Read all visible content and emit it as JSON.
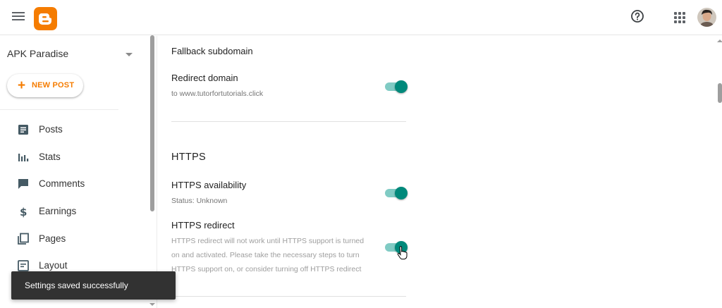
{
  "app": {
    "name": "Blogger",
    "brand_color": "#f57c00",
    "accent_color": "#00897b",
    "icons": {
      "menu": "hamburger-menu-icon",
      "logo": "blogger-logo-icon",
      "help": "help-circle-icon",
      "apps": "apps-grid-icon",
      "avatar": "user-avatar"
    }
  },
  "sidebar": {
    "blog_name": "APK Paradise",
    "new_post_label": "NEW POST",
    "items": [
      {
        "label": "Posts",
        "icon": "posts-icon"
      },
      {
        "label": "Stats",
        "icon": "stats-icon"
      },
      {
        "label": "Comments",
        "icon": "comments-icon"
      },
      {
        "label": "Earnings",
        "icon": "dollar-icon"
      },
      {
        "label": "Pages",
        "icon": "pages-icon"
      },
      {
        "label": "Layout",
        "icon": "layout-icon"
      }
    ]
  },
  "settings": {
    "fallback_subdomain": {
      "title": "Fallback subdomain"
    },
    "redirect_domain": {
      "title": "Redirect domain",
      "subtitle": "to www.tutorfortutorials.click",
      "enabled": true
    },
    "https_section": {
      "heading": "HTTPS"
    },
    "https_availability": {
      "title": "HTTPS availability",
      "subtitle": "Status: Unknown",
      "enabled": true
    },
    "https_redirect": {
      "title": "HTTPS redirect",
      "description_lines": [
        "HTTPS redirect will not work until HTTPS support is turned",
        "on and activated. Please take the necessary steps to turn",
        "HTTPS support on, or consider turning off HTTPS redirect"
      ],
      "enabled": true
    }
  },
  "toast": {
    "message": "Settings saved successfully"
  }
}
